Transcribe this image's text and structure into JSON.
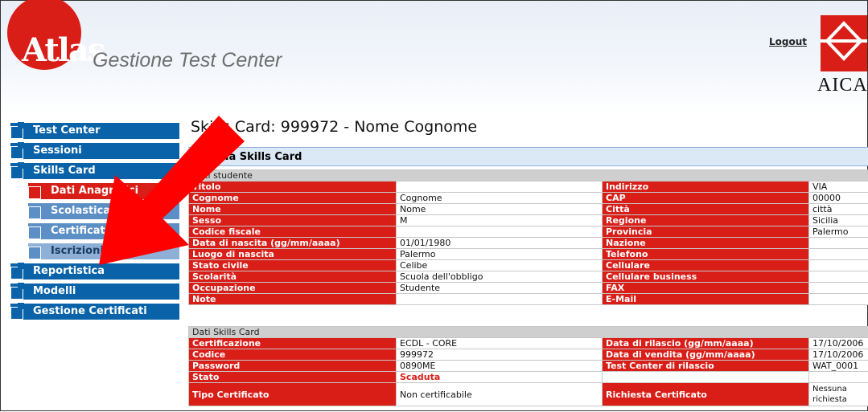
{
  "header": {
    "logo": "Atlas",
    "app_title": "Gestione Test Center",
    "logout": "Logout",
    "partner_logo": "AICA"
  },
  "sidebar": {
    "items": [
      {
        "label": "Test Center"
      },
      {
        "label": "Sessioni"
      },
      {
        "label": "Skills Card"
      }
    ],
    "sub_items": [
      {
        "label": "Dati Anagrafici"
      },
      {
        "label": "Scolastica"
      },
      {
        "label": "Certificati"
      },
      {
        "label": "Iscrizioni"
      }
    ],
    "bottom_items": [
      {
        "label": "Reportistica"
      },
      {
        "label": "Modelli"
      },
      {
        "label": "Gestione Certificati"
      }
    ]
  },
  "main": {
    "page_title": "Skills Card: 999972 - Nome Cognome",
    "section_title": "Scheda Skills Card",
    "student_header": "Dati studente",
    "left_rows": [
      {
        "label": "Titolo",
        "value": ""
      },
      {
        "label": "Cognome",
        "value": "Cognome"
      },
      {
        "label": "Nome",
        "value": "Nome"
      },
      {
        "label": "Sesso",
        "value": "M"
      },
      {
        "label": "Codice fiscale",
        "value": ""
      },
      {
        "label": "Data di nascita (gg/mm/aaaa)",
        "value": "01/01/1980"
      },
      {
        "label": "Luogo di nascita",
        "value": "Palermo"
      },
      {
        "label": "Stato civile",
        "value": "Celibe"
      },
      {
        "label": "Scolarità",
        "value": "Scuola dell'obbligo"
      },
      {
        "label": "Occupazione",
        "value": "Studente"
      },
      {
        "label": "Note",
        "value": ""
      }
    ],
    "right_rows": [
      {
        "label": "Indirizzo",
        "value": "VIA"
      },
      {
        "label": "CAP",
        "value": "00000"
      },
      {
        "label": "Città",
        "value": "città"
      },
      {
        "label": "Regione",
        "value": "Sicilia"
      },
      {
        "label": "Provincia",
        "value": "Palermo"
      },
      {
        "label": "Nazione",
        "value": ""
      },
      {
        "label": "Telefono",
        "value": ""
      },
      {
        "label": "Cellulare",
        "value": ""
      },
      {
        "label": "Cellulare business",
        "value": ""
      },
      {
        "label": "FAX",
        "value": ""
      },
      {
        "label": "E-Mail",
        "value": ""
      }
    ],
    "card_header": "Dati Skills Card",
    "card_left": [
      {
        "label": "Certificazione",
        "value": "ECDL - CORE"
      },
      {
        "label": "Codice",
        "value": "999972"
      },
      {
        "label": "Password",
        "value": "0890ME"
      },
      {
        "label": "Stato",
        "value": "Scaduta"
      },
      {
        "label": "Tipo Certificato",
        "value": "Non certificabile"
      }
    ],
    "card_right": [
      {
        "label": "Data di rilascio (gg/mm/aaaa)",
        "value": "17/10/2006"
      },
      {
        "label": "Data di vendita (gg/mm/aaaa)",
        "value": "17/10/2006"
      },
      {
        "label": "Test Center di rilascio",
        "value": "WAT_0001"
      },
      {
        "label": "",
        "value": ""
      },
      {
        "label": "Richiesta Certificato",
        "value": "Nessuna richiesta"
      }
    ]
  },
  "colors": {
    "brand_red": "#d91e18",
    "nav_blue": "#0a63a8",
    "sub_blue": "#5b8fc5",
    "header_gray": "#cfcfcf"
  }
}
